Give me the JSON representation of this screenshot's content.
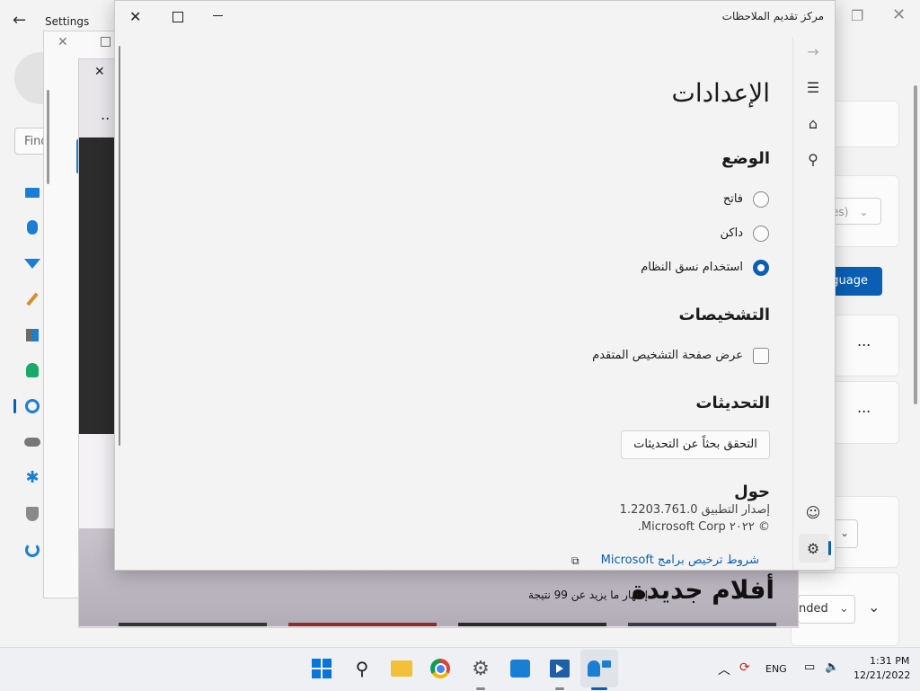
{
  "settings": {
    "title": "Settings",
    "search_placeholder": "Find",
    "dropdown1_value": "es)",
    "language_button": "guage",
    "dropdown2_value": "nded",
    "more": "..."
  },
  "movies": {
    "more": "..",
    "title": "أفلام جديدة",
    "subtitle": "إظهار ما يزيد عن 99 نتيجة"
  },
  "feedback": {
    "window_title": "مركز تقديم الملاحظات",
    "page_title": "الإعدادات",
    "mode_heading": "الوضع",
    "mode_options": [
      "فاتح",
      "داكن",
      "استخدام نسق النظام"
    ],
    "mode_selected": 2,
    "diagnostics_heading": "التشخيصات",
    "diagnostics_checkbox": "عرض صفحة التشخيص المتقدم",
    "updates_heading": "التحديثات",
    "check_updates_button": "التحقق بحثاً عن التحديثات",
    "about_heading": "حول",
    "version": "إصدار التطبيق 1.2203.761.0",
    "copyright": "© ٢٠٢٢ Microsoft Corp.",
    "license_link": "شروط ترخيص برامج Microsoft"
  },
  "taskbar": {
    "lang": "ENG",
    "time": "1:31 PM",
    "date": "12/21/2022"
  },
  "colors": {
    "accent": "#0a5fb4"
  }
}
